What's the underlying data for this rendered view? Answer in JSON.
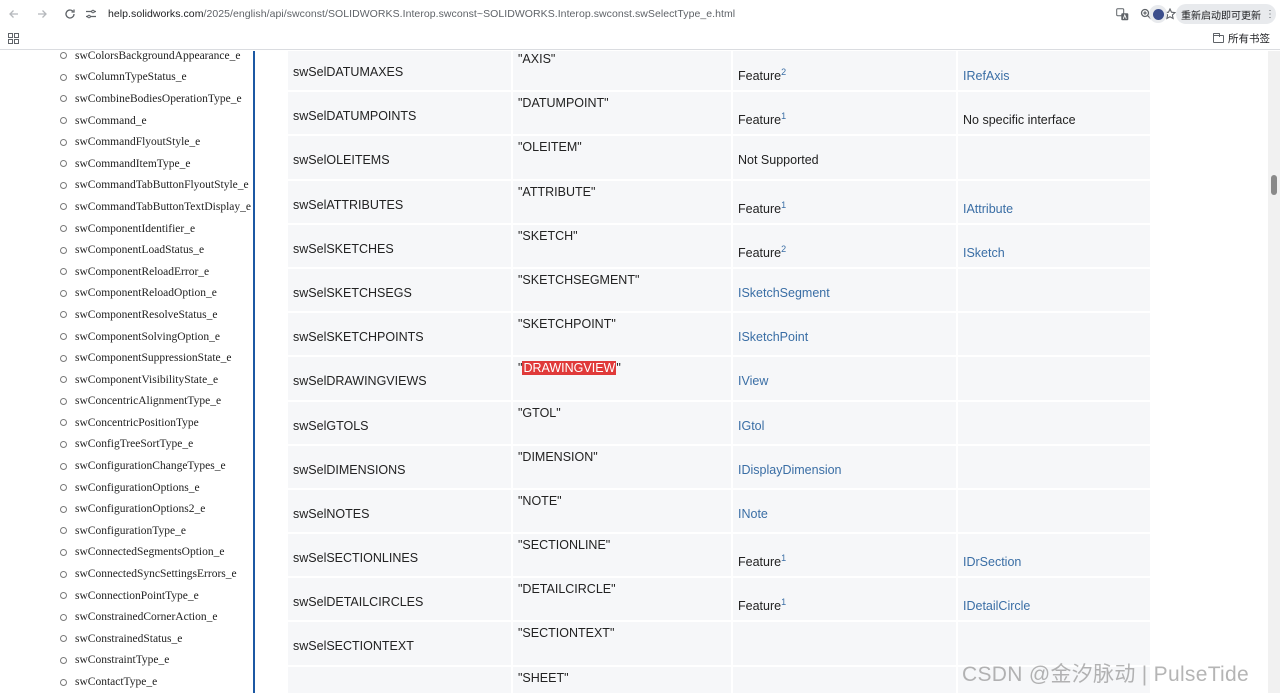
{
  "browser": {
    "url_host": "help.solidworks.com",
    "url_path": "/2025/english/api/swconst/SOLIDWORKS.Interop.swconst~SOLIDWORKS.Interop.swconst.swSelectType_e.html",
    "update_label": "重新启动即可更新",
    "all_bookmarks_label": "所有书签",
    "icons": {
      "back": "arrow-left-icon",
      "forward": "arrow-right-icon",
      "reload": "reload-icon",
      "site_info": "tune-icon",
      "translate": "translate-icon",
      "zoom": "zoom-icon",
      "bookmark": "star-icon",
      "profile": "profile-icon",
      "menu": "more-vert-icon",
      "apps": "apps-grid-icon",
      "folder": "folder-icon"
    }
  },
  "sidebar": {
    "items": [
      "swColorsBackgroundAppearance_e",
      "swColumnTypeStatus_e",
      "swCombineBodiesOperationType_e",
      "swCommand_e",
      "swCommandFlyoutStyle_e",
      "swCommandItemType_e",
      "swCommandTabButtonFlyoutStyle_e",
      "swCommandTabButtonTextDisplay_e",
      "swComponentIdentifier_e",
      "swComponentLoadStatus_e",
      "swComponentReloadError_e",
      "swComponentReloadOption_e",
      "swComponentResolveStatus_e",
      "swComponentSolvingOption_e",
      "swComponentSuppressionState_e",
      "swComponentVisibilityState_e",
      "swConcentricAlignmentType_e",
      "swConcentricPositionType",
      "swConfigTreeSortType_e",
      "swConfigurationChangeTypes_e",
      "swConfigurationOptions_e",
      "swConfigurationOptions2_e",
      "swConfigurationType_e",
      "swConnectedSegmentsOption_e",
      "swConnectedSyncSettingsErrors_e",
      "swConnectionPointType_e",
      "swConstrainedCornerAction_e",
      "swConstrainedStatus_e",
      "swConstraintType_e",
      "swContactType_e"
    ]
  },
  "table": {
    "rows": [
      {
        "name": "swSelDATUMAXES",
        "string": "\"AXIS\"",
        "support": "Feature",
        "sup": "2",
        "interface": "IRefAxis",
        "iface_link": true
      },
      {
        "name": "swSelDATUMPOINTS",
        "string": "\"DATUMPOINT\"",
        "support": "Feature",
        "sup": "1",
        "interface": "No specific interface",
        "iface_link": false
      },
      {
        "name": "swSelOLEITEMS",
        "string": "\"OLEITEM\"",
        "support": "Not Supported",
        "sup": "",
        "interface": "",
        "iface_link": false
      },
      {
        "name": "swSelATTRIBUTES",
        "string": "\"ATTRIBUTE\"",
        "support": "Feature",
        "sup": "1",
        "interface": "IAttribute",
        "iface_link": true
      },
      {
        "name": "swSelSKETCHES",
        "string": "\"SKETCH\"",
        "support": "Feature",
        "sup": "2",
        "interface": "ISketch",
        "iface_link": true
      },
      {
        "name": "swSelSKETCHSEGS",
        "string": "\"SKETCHSEGMENT\"",
        "support": "ISketchSegment",
        "support_link": true,
        "sup": "",
        "interface": "",
        "iface_link": false
      },
      {
        "name": "swSelSKETCHPOINTS",
        "string": "\"SKETCHPOINT\"",
        "support": "ISketchPoint",
        "support_link": true,
        "sup": "",
        "interface": "",
        "iface_link": false
      },
      {
        "name": "swSelDRAWINGVIEWS",
        "string": "DRAWINGVIEW",
        "highlight": true,
        "support": "IView",
        "support_link": true,
        "sup": "",
        "interface": "",
        "iface_link": false
      },
      {
        "name": "swSelGTOLS",
        "string": "\"GTOL\"",
        "support": "IGtol",
        "support_link": true,
        "sup": "",
        "interface": "",
        "iface_link": false
      },
      {
        "name": "swSelDIMENSIONS",
        "string": "\"DIMENSION\"",
        "support": "IDisplayDimension",
        "support_link": true,
        "sup": "",
        "interface": "",
        "iface_link": false
      },
      {
        "name": "swSelNOTES",
        "string": "\"NOTE\"",
        "support": "INote",
        "support_link": true,
        "sup": "",
        "interface": "",
        "iface_link": false
      },
      {
        "name": "swSelSECTIONLINES",
        "string": "\"SECTIONLINE\"",
        "support": "Feature",
        "sup": "1",
        "interface": "IDrSection",
        "iface_link": true
      },
      {
        "name": "swSelDETAILCIRCLES",
        "string": "\"DETAILCIRCLE\"",
        "support": "Feature",
        "sup": "1",
        "interface": "IDetailCircle",
        "iface_link": true
      },
      {
        "name": "swSelSECTIONTEXT",
        "string": "\"SECTIONTEXT\"",
        "support": "",
        "sup": "",
        "interface": "",
        "iface_link": false
      },
      {
        "name": "",
        "string": "\"SHEET\"",
        "support": "",
        "sup": "",
        "interface": "",
        "iface_link": false
      }
    ]
  },
  "watermark": "CSDN @金汐脉动 | PulseTide",
  "colors": {
    "link": "#3a6ea5",
    "highlight": "#e03a3a",
    "sidebar_divider": "#1c58a3",
    "cell_bg": "#f6f7f9"
  }
}
